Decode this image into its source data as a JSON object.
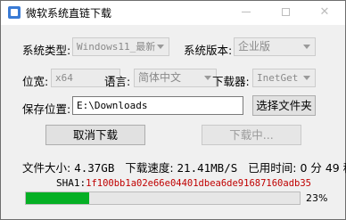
{
  "window": {
    "title": "微软系统直链下载",
    "controls": {
      "minimize": "—",
      "maximize": "□",
      "close": "✕"
    }
  },
  "form": {
    "system_type": {
      "label": "系统类型:",
      "value": "Windows11_最新"
    },
    "system_edition": {
      "label": "系统版本:",
      "value": "企业版"
    },
    "arch": {
      "label": "位宽:",
      "value": "x64"
    },
    "language": {
      "label": "语言:",
      "value": "简体中文"
    },
    "downloader": {
      "label": "下载器:",
      "value": "InetGet"
    },
    "save_path": {
      "label": "保存位置:",
      "value": "E:\\Downloads"
    },
    "choose_folder_button": "选择文件夹"
  },
  "buttons": {
    "cancel_download": "取消下载",
    "download": "下载中..."
  },
  "status": {
    "file_size_label": "文件大小:",
    "file_size": "4.37GB",
    "speed_label": "下载速度:",
    "speed": "21.41MB/S",
    "elapsed_label": "已用时间:",
    "elapsed": "0 分 49 秒",
    "sha1_label": "SHA1:",
    "sha1": "1f100bb1a02e66e04401dbea6de91687160adb35"
  },
  "progress": {
    "value": 0.23,
    "label": "23%"
  },
  "colors": {
    "progress_fill": "#06b025",
    "sha_text": "#c00000"
  }
}
